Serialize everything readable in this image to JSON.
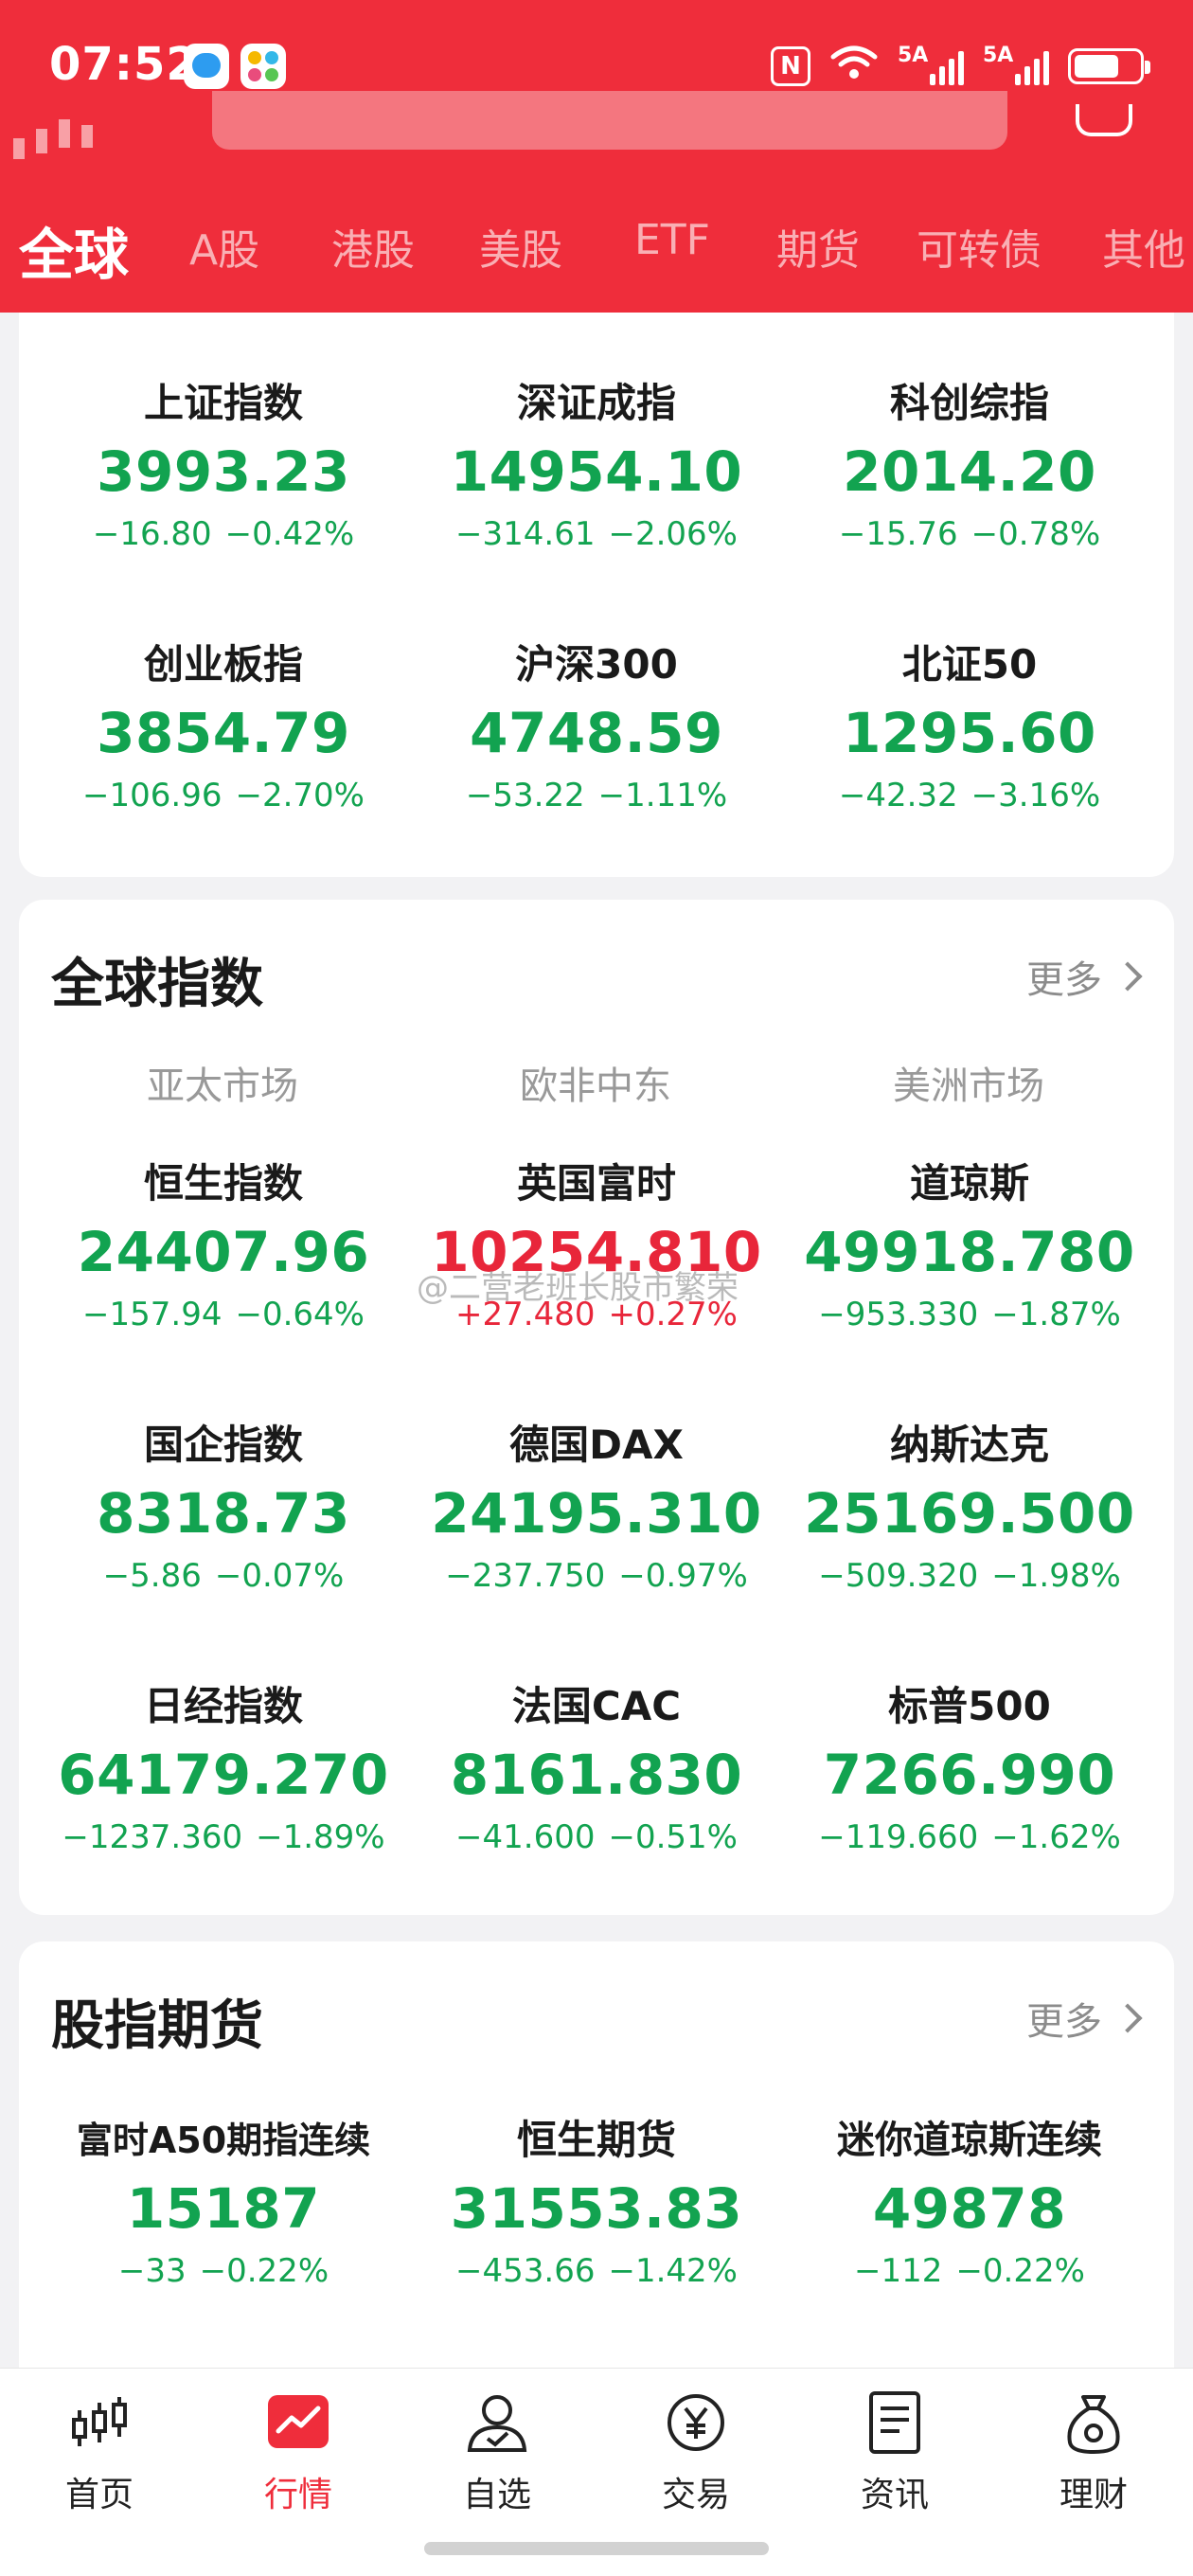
{
  "status_bar": {
    "time": "07:52",
    "nfc": "N",
    "wifi_label": "6",
    "signal1": "5A",
    "signal2": "5A"
  },
  "tabs": [
    "全球",
    "A股",
    "港股",
    "美股",
    "ETF",
    "期货",
    "可转债",
    "其他"
  ],
  "domestic_indices": [
    {
      "name": "上证指数",
      "value": "3993.23",
      "change": "−16.80",
      "pct": "−0.42%",
      "trend": "down"
    },
    {
      "name": "深证成指",
      "value": "14954.10",
      "change": "−314.61",
      "pct": "−2.06%",
      "trend": "down"
    },
    {
      "name": "科创综指",
      "value": "2014.20",
      "change": "−15.76",
      "pct": "−0.78%",
      "trend": "down"
    },
    {
      "name": "创业板指",
      "value": "3854.79",
      "change": "−106.96",
      "pct": "−2.70%",
      "trend": "down"
    },
    {
      "name": "沪深300",
      "value": "4748.59",
      "change": "−53.22",
      "pct": "−1.11%",
      "trend": "down"
    },
    {
      "name": "北证50",
      "value": "1295.60",
      "change": "−42.32",
      "pct": "−3.16%",
      "trend": "down"
    }
  ],
  "global_section": {
    "title": "全球指数",
    "more": "更多",
    "regions": [
      "亚太市场",
      "欧非中东",
      "美洲市场"
    ],
    "items": [
      {
        "name": "恒生指数",
        "value": "24407.96",
        "change": "−157.94",
        "pct": "−0.64%",
        "trend": "down"
      },
      {
        "name": "英国富时",
        "value": "10254.810",
        "change": "+27.480",
        "pct": "+0.27%",
        "trend": "up"
      },
      {
        "name": "道琼斯",
        "value": "49918.780",
        "change": "−953.330",
        "pct": "−1.87%",
        "trend": "down"
      },
      {
        "name": "国企指数",
        "value": "8318.73",
        "change": "−5.86",
        "pct": "−0.07%",
        "trend": "down"
      },
      {
        "name": "德国DAX",
        "value": "24195.310",
        "change": "−237.750",
        "pct": "−0.97%",
        "trend": "down"
      },
      {
        "name": "纳斯达克",
        "value": "25169.500",
        "change": "−509.320",
        "pct": "−1.98%",
        "trend": "down"
      },
      {
        "name": "日经指数",
        "value": "64179.270",
        "change": "−1237.360",
        "pct": "−1.89%",
        "trend": "down"
      },
      {
        "name": "法国CAC",
        "value": "8161.830",
        "change": "−41.600",
        "pct": "−0.51%",
        "trend": "down"
      },
      {
        "name": "标普500",
        "value": "7266.990",
        "change": "−119.660",
        "pct": "−1.62%",
        "trend": "down"
      }
    ]
  },
  "watermark": "@二营老班长股市繁荣",
  "futures_section": {
    "title": "股指期货",
    "more": "更多",
    "items": [
      {
        "name": "富时A50期指连续",
        "value": "15187",
        "change": "−33",
        "pct": "−0.22%",
        "trend": "down"
      },
      {
        "name": "恒生期货",
        "value": "31553.83",
        "change": "−453.66",
        "pct": "−1.42%",
        "trend": "down"
      },
      {
        "name": "迷你道琼斯连续",
        "value": "49878",
        "change": "−112",
        "pct": "−0.22%",
        "trend": "down"
      }
    ]
  },
  "bottom_nav": [
    {
      "label": "首页",
      "icon": "candlestick-icon",
      "active": false
    },
    {
      "label": "行情",
      "icon": "market-chart-icon",
      "active": true
    },
    {
      "label": "自选",
      "icon": "user-check-icon",
      "active": false
    },
    {
      "label": "交易",
      "icon": "yuan-coin-icon",
      "active": false
    },
    {
      "label": "资讯",
      "icon": "news-doc-icon",
      "active": false
    },
    {
      "label": "理财",
      "icon": "money-bag-icon",
      "active": false
    }
  ],
  "colors": {
    "brand_red": "#ef2d3b",
    "down_green": "#12a350",
    "up_red": "#e8263a"
  }
}
